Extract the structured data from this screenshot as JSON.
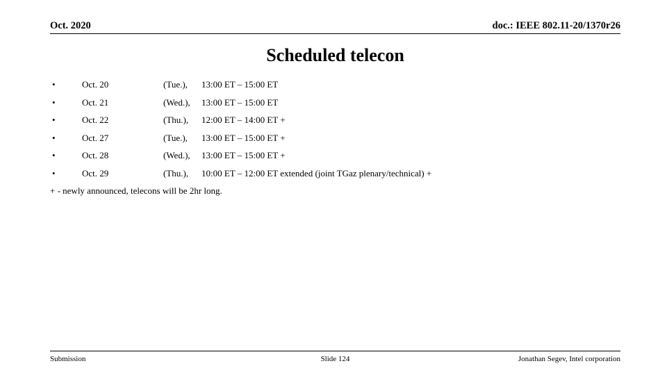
{
  "header": {
    "left": "Oct. 2020",
    "right": "doc.: IEEE 802.11-20/1370r26"
  },
  "title": "Scheduled telecon",
  "bullets": {
    "marker": "•",
    "rows": [
      {
        "date": "Oct. 20",
        "day": "(Tue.),",
        "time": "13:00 ET – 15:00 ET"
      },
      {
        "date": "Oct. 21",
        "day": "(Wed.),",
        "time": "13:00 ET – 15:00 ET"
      },
      {
        "date": "Oct. 22",
        "day": "(Thu.),",
        "time": "12:00 ET – 14:00 ET +"
      },
      {
        "date": "Oct. 27",
        "day": "(Tue.),",
        "time": "13:00 ET – 15:00 ET +"
      },
      {
        "date": "Oct. 28",
        "day": "(Wed.),",
        "time": "13:00 ET – 15:00 ET +"
      },
      {
        "date": "Oct. 29",
        "day": "(Thu.),",
        "time": "10:00 ET – 12:00 ET extended (joint TGaz plenary/technical) +"
      }
    ]
  },
  "footnote": "+ - newly announced, telecons will be 2hr long.",
  "footer": {
    "left": "Submission",
    "center": "Slide 124",
    "right": "Jonathan Segev, Intel corporation"
  },
  "colors": {
    "text": "#000000",
    "background": "#ffffff",
    "rule": "#000000"
  }
}
